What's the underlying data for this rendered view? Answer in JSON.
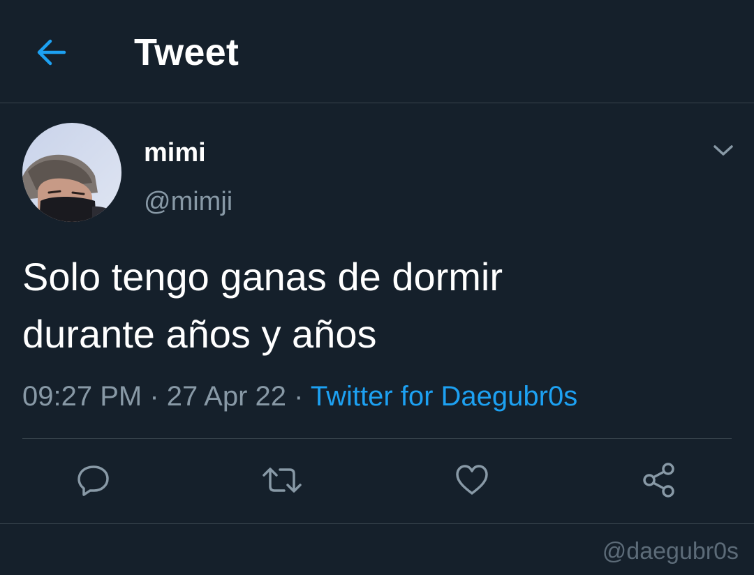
{
  "header": {
    "title": "Tweet",
    "back_icon": "arrow-left-icon"
  },
  "tweet": {
    "author": {
      "display_name": "mimi",
      "handle": "@mimji",
      "avatar_icon": "avatar"
    },
    "text_line1": "Solo tengo ganas de dormir",
    "text_line2": "durante años y años",
    "time": "09:27 PM",
    "separator": " · ",
    "date": "27 Apr 22",
    "source": "Twitter for Daegubr0s",
    "menu_icon": "chevron-down-icon"
  },
  "actions": [
    {
      "name": "reply",
      "icon": "reply-icon"
    },
    {
      "name": "retweet",
      "icon": "retweet-icon"
    },
    {
      "name": "like",
      "icon": "heart-icon"
    },
    {
      "name": "share",
      "icon": "share-icon"
    }
  ],
  "watermark": "@daegubr0s",
  "colors": {
    "background": "#15202b",
    "accent": "#1da1f2",
    "secondary_text": "#8899a6",
    "divider": "#38444d"
  }
}
